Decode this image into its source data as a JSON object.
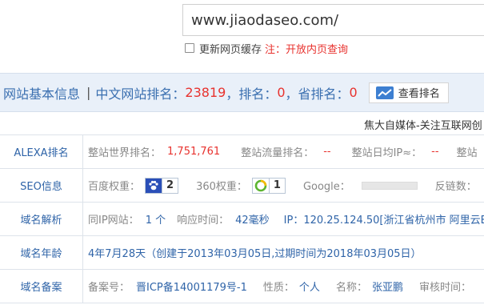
{
  "url_input": {
    "value": "www.jiaodaseo.com/"
  },
  "cache": {
    "label": "更新网页缓存",
    "note": "注：开放内页查询"
  },
  "header": {
    "title": "网站基本信息",
    "separator": "|",
    "cn_rank_label": "中文网站排名：",
    "cn_rank_value": "23819",
    "rank_label": "，排名：",
    "rank_value": "0",
    "province_label": "，省排名：",
    "province_value": "0",
    "button_label": "查看排名"
  },
  "marquee": "焦大自媒体-关注互联网创",
  "rows": {
    "alexa": {
      "label": "ALEXA排名",
      "world_key": "整站世界排名：",
      "world_val": "1,751,761",
      "traffic_key": "整站流量排名：",
      "traffic_val": "--",
      "daily_ip_key": "整站日均IP≈：",
      "daily_ip_val": "--",
      "more_key": "整站"
    },
    "seo": {
      "label": "SEO信息",
      "baidu_key": "百度权重：",
      "baidu_val": "2",
      "s360_key": "360权重：",
      "s360_val": "1",
      "google_key": "Google：",
      "backlinks_key": "反链数："
    },
    "dns": {
      "label": "域名解析",
      "same_ip_key": "同IP网站：",
      "same_ip_val": "1 个",
      "resp_key": "响应时间：",
      "resp_val": "42毫秒",
      "ip_text": "IP：120.25.124.50[浙江省杭州市 阿里云B"
    },
    "age": {
      "label": "域名年龄",
      "text": "4年7月28天（创建于2013年03月05日,过期时间为2018年03月05日）"
    },
    "icp": {
      "label": "域名备案",
      "no_key": "备案号：",
      "no_val": "晋ICP备14001179号-1",
      "nature_key": "性质：",
      "nature_val": "个人",
      "name_key": "名称：",
      "name_val": "张亚鹏",
      "time_key": "审核时间："
    }
  },
  "colors": {
    "link": "#2f64a8",
    "accent_red": "#e8322e",
    "header_bg": "#e9f0f9"
  }
}
